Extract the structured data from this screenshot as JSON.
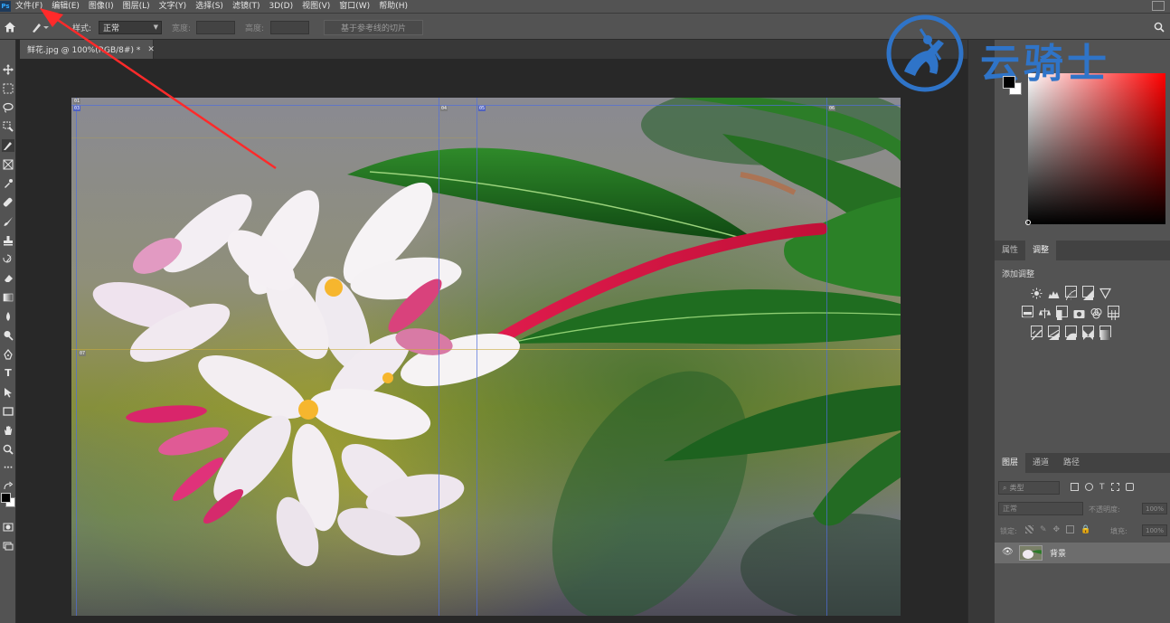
{
  "menubar": {
    "items": [
      "文件(F)",
      "编辑(E)",
      "图像(I)",
      "图层(L)",
      "文字(Y)",
      "选择(S)",
      "滤镜(T)",
      "3D(D)",
      "视图(V)",
      "窗口(W)",
      "帮助(H)"
    ]
  },
  "options": {
    "style_label": "样式:",
    "style_value": "正常",
    "width_label": "宽度:",
    "height_label": "高度:",
    "guides_button": "基于参考线的切片"
  },
  "document": {
    "tab_title": "鲜花.jpg @ 100%(RGB/8#) *"
  },
  "slices": {
    "labels": [
      "01",
      "03",
      "04",
      "05",
      "06",
      "07"
    ]
  },
  "properties_panel": {
    "tabs": [
      "属性",
      "调整"
    ],
    "title": "添加调整"
  },
  "layers_panel": {
    "tabs": [
      "图层",
      "通道",
      "路径"
    ],
    "filter_placeholder": "类型",
    "blend_mode": "正常",
    "opacity_label": "不透明度:",
    "opacity_value": "100%",
    "lock_label": "锁定:",
    "fill_label": "填充:",
    "fill_value": "100%",
    "layers": [
      {
        "name": "背景"
      }
    ]
  },
  "watermark": {
    "text": "云骑士"
  },
  "colors": {
    "accent_blue": "#2f74c8",
    "annotation_red": "#ff2a2a"
  }
}
